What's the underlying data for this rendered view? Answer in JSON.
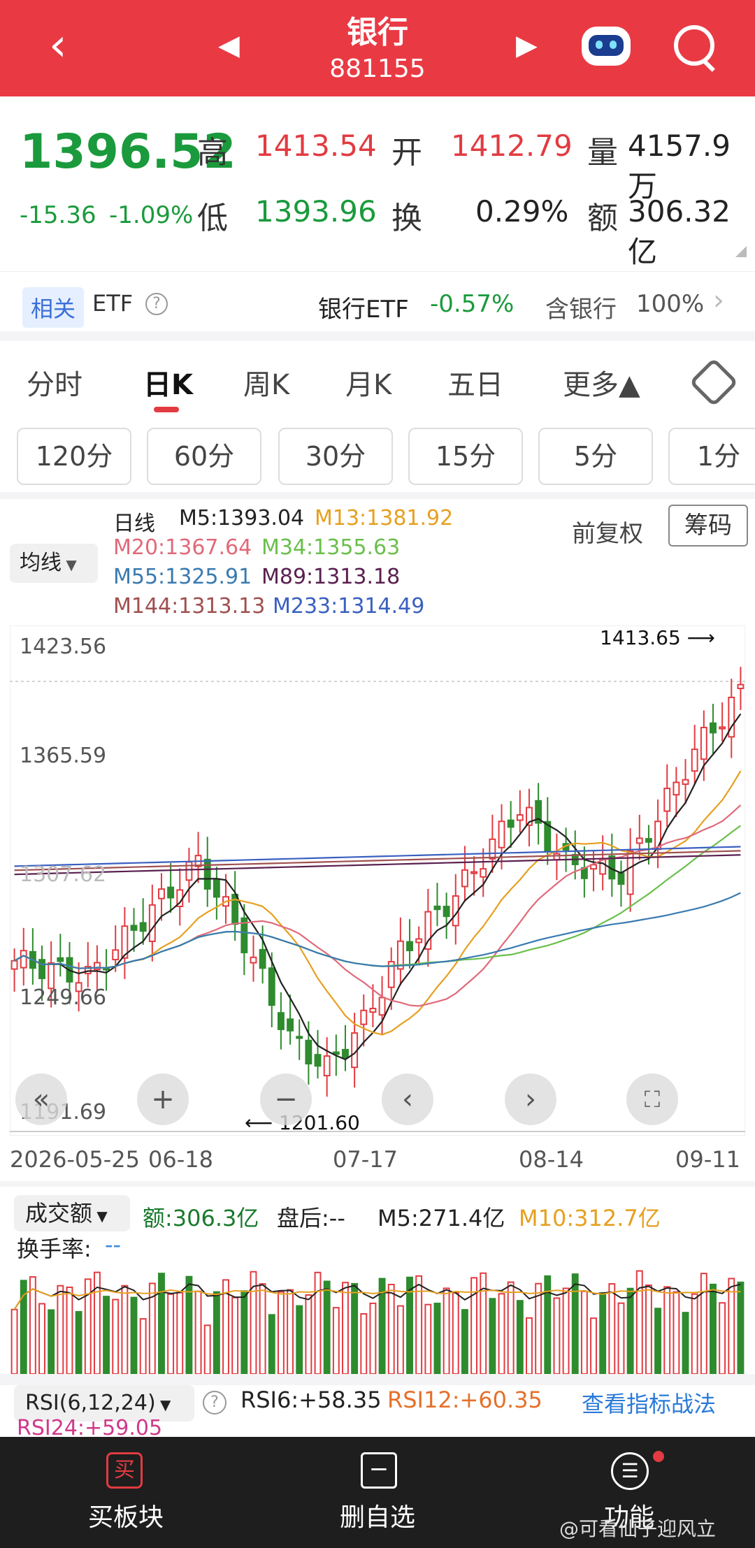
{
  "header": {
    "title": "银行",
    "code": "881155"
  },
  "quote": {
    "price": "1396.52",
    "change": "-15.36",
    "change_pct": "-1.09%",
    "high_label": "高",
    "high": "1413.54",
    "open_label": "开",
    "open": "1412.79",
    "vol_label": "量",
    "volume": "4157.9万",
    "low_label": "低",
    "low": "1393.96",
    "turn_label": "换",
    "turnover": "0.29%",
    "amt_label": "额",
    "amount": "306.32亿"
  },
  "related": {
    "tag": "相关",
    "etf": "ETF",
    "etf_name": "银行ETF",
    "etf_change": "-0.57%",
    "contains": "含银行",
    "contains_pct": "100%"
  },
  "tabs": [
    "分时",
    "日K",
    "周K",
    "月K",
    "五日",
    "更多▲"
  ],
  "minute_chips": [
    "120分",
    "60分",
    "30分",
    "15分",
    "5分",
    "1分"
  ],
  "ma": {
    "selector": "均线",
    "kind": "日线",
    "m5": "M5:1393.04",
    "m13": "M13:1381.92",
    "m20": "M20:1367.64",
    "m34": "M34:1355.63",
    "m55": "M55:1325.91",
    "m89": "M89:1313.18",
    "m144": "M144:1313.13",
    "m233": "M233:1314.49",
    "adj": "前复权",
    "chip_btn": "筹码"
  },
  "kchart": {
    "y_labels": [
      "1423.56",
      "1365.59",
      "1307.62",
      "1249.66",
      "1191.69"
    ],
    "high_mark": "1413.65",
    "low_mark": "1201.60",
    "x_labels": [
      "2026-05-25",
      "06-18",
      "07-17",
      "08-14",
      "09-11"
    ]
  },
  "volume": {
    "selector": "成交额",
    "amt": "额:306.3亿",
    "after": "盘后:--",
    "m5": "M5:271.4亿",
    "m10": "M10:312.7亿",
    "turn": "换手率:",
    "turn_val": "--"
  },
  "rsi": {
    "selector": "RSI(6,12,24)",
    "rsi6": "RSI6:+58.35",
    "rsi12": "RSI12:+60.35",
    "rsi24": "RSI24:+59.05",
    "link": "查看指标战法"
  },
  "bottom": {
    "buy": "买板块",
    "buy_icon": "买",
    "remove": "删自选",
    "func": "功能",
    "func_icon": "☰"
  },
  "watermark": "@可看仙子迎风立",
  "colors": {
    "red": "#e23b41",
    "green": "#1a9a3c",
    "m5": "#222222",
    "m13": "#e6a020",
    "m20": "#e06a7a",
    "m34": "#6abf4b",
    "m55": "#3a7ab0",
    "m89": "#5a2050",
    "m144": "#a05050",
    "m233": "#3a60c0"
  }
}
